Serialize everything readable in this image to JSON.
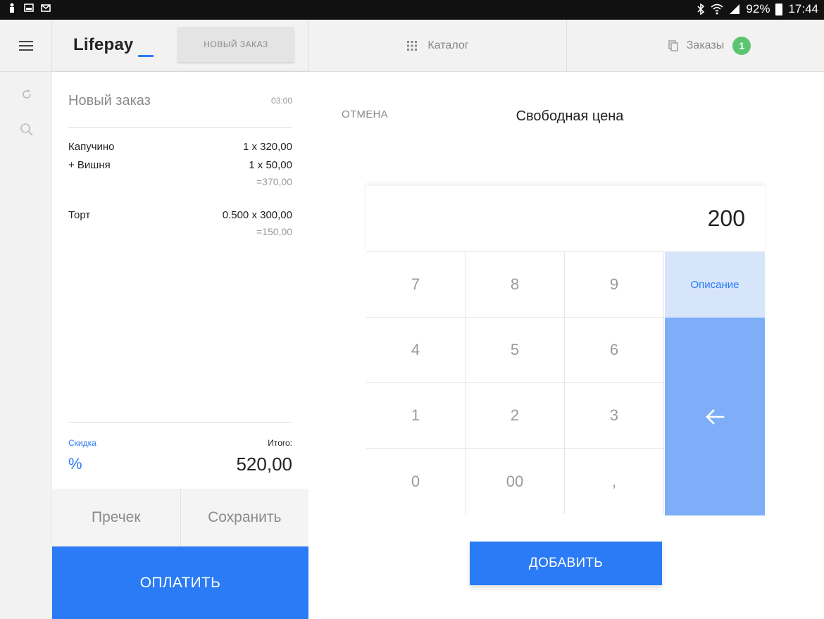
{
  "statusbar": {
    "battery_text": "92%",
    "time": "17:44"
  },
  "header": {
    "brand": "Lifepay",
    "new_order_tab": "НОВЫЙ ЗАКАЗ",
    "catalog_label": "Каталог",
    "orders_label": "Заказы",
    "orders_count": "1"
  },
  "order": {
    "title": "Новый заказ",
    "time": "03:00",
    "items": [
      {
        "name": "Капучино",
        "qty": "1 x 320,00"
      },
      {
        "name": "+ Вишня",
        "qty": "1 x 50,00",
        "sum": "=370,00"
      },
      {
        "name": "Торт",
        "qty": "0.500 x 300,00",
        "sum": "=150,00"
      }
    ],
    "discount_label": "Скидка",
    "discount_sign": "%",
    "total_label": "Итого:",
    "total_value": "520,00",
    "precheck_label": "Пречек",
    "save_label": "Сохранить",
    "pay_label": "ОПЛАТИТЬ"
  },
  "price_entry": {
    "cancel_label": "ОТМЕНА",
    "title": "Свободная цена",
    "display_value": "200",
    "keys": [
      "7",
      "8",
      "9",
      "4",
      "5",
      "6",
      "1",
      "2",
      "3",
      "0",
      "00",
      ","
    ],
    "description_label": "Описание",
    "add_label": "ДОБАВИТЬ"
  },
  "colors": {
    "accent": "#2a7bf5",
    "badge": "#5cc470",
    "backspace_bg": "#7eaef8",
    "description_bg": "#d7e5fb"
  }
}
